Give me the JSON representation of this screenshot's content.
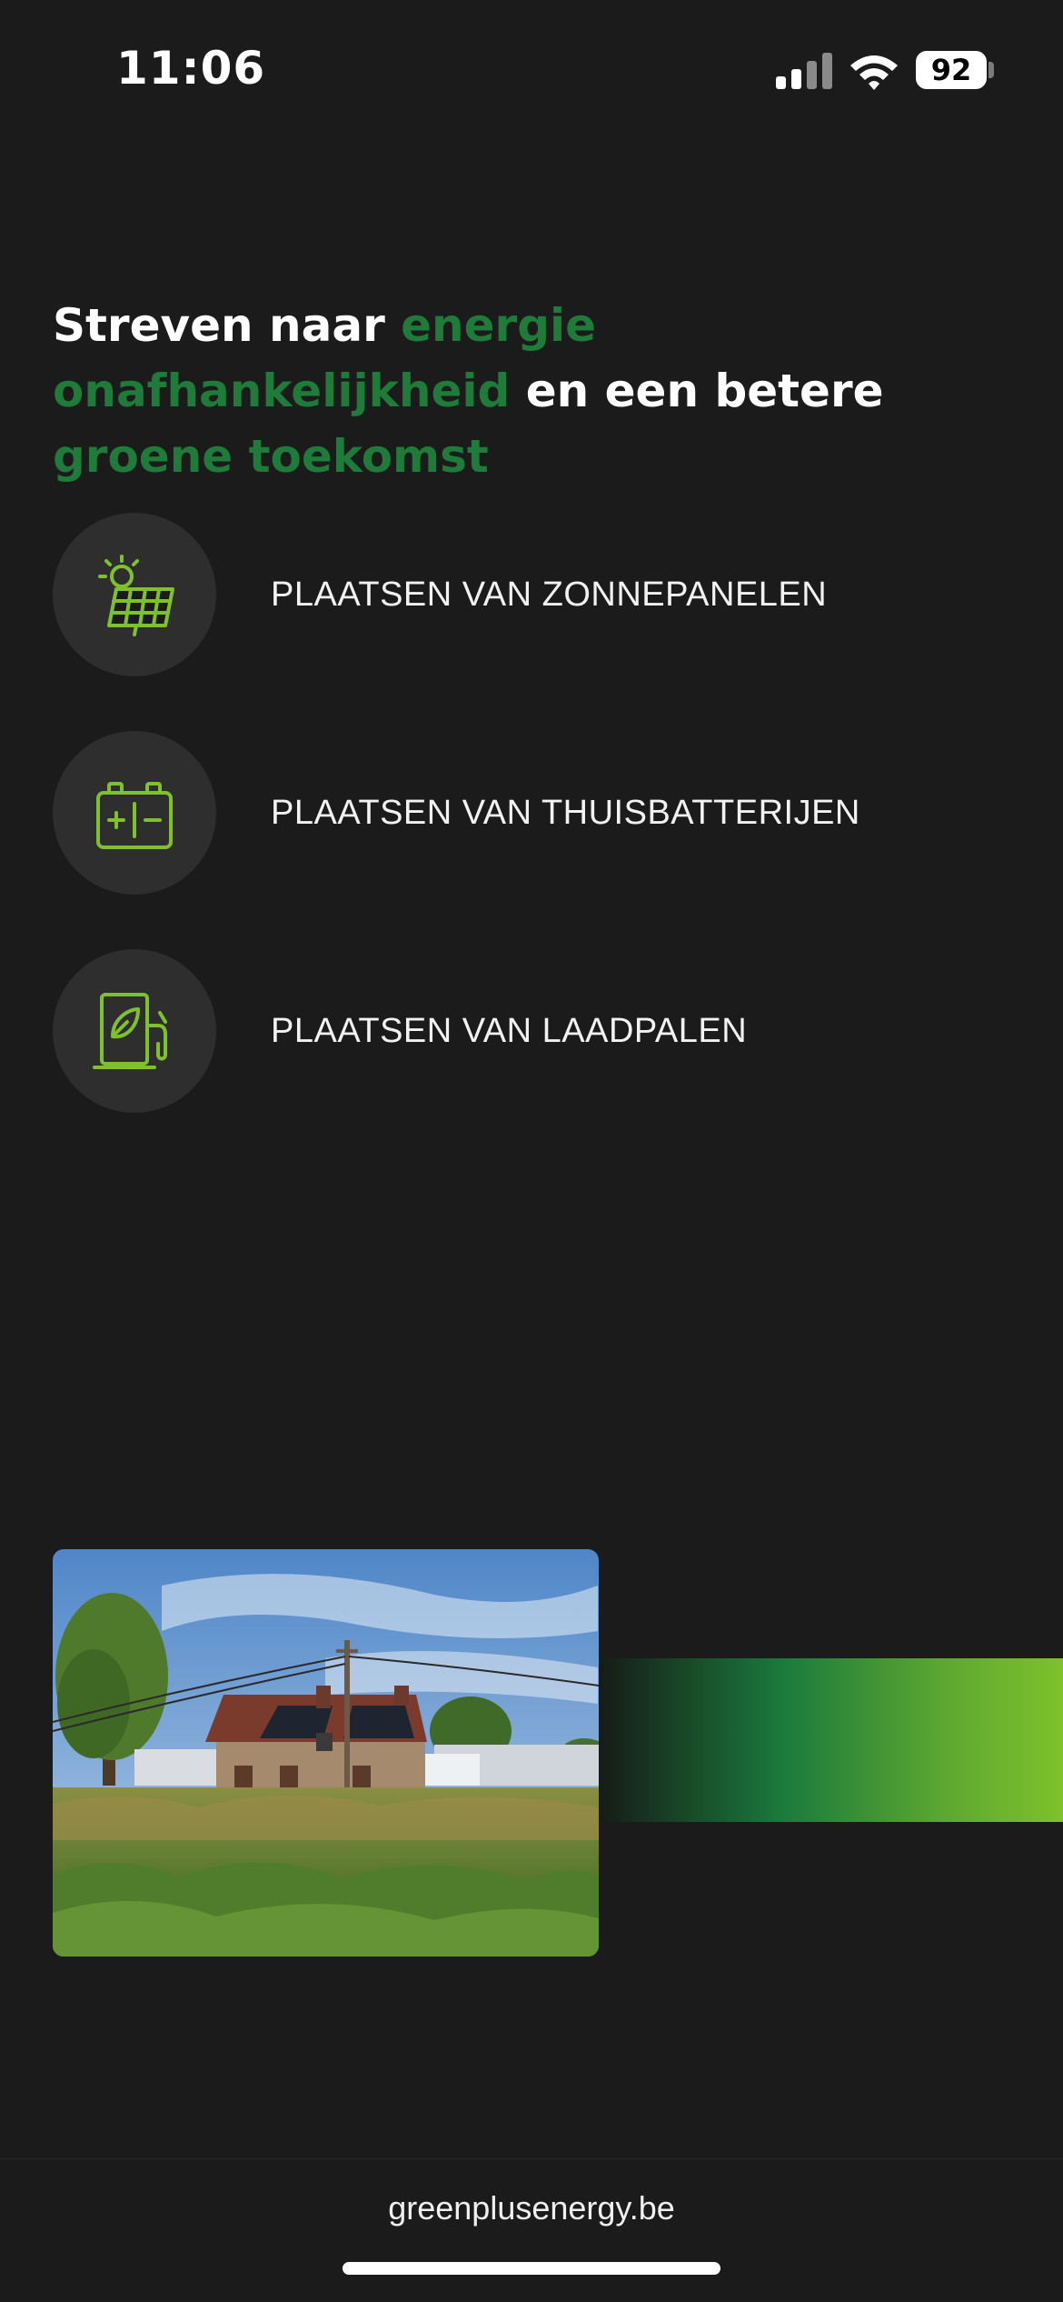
{
  "status_bar": {
    "time": "11:06",
    "battery": "92",
    "icons": [
      "cellular-signal-icon",
      "wifi-icon",
      "battery-icon"
    ]
  },
  "headline": {
    "part1": "Streven naar ",
    "highlight1": "energie onafhankelijkheid",
    "part2": " en een betere ",
    "highlight2": "groene toekomst"
  },
  "services": [
    {
      "label": "PLAATSEN VAN ZONNEPANELEN",
      "icon": "solar-panel-icon"
    },
    {
      "label": "PLAATSEN VAN THUISBATTERIJEN",
      "icon": "battery-icon"
    },
    {
      "label": "PLAATSEN VAN LAADPALEN",
      "icon": "ev-charger-icon"
    }
  ],
  "footer": {
    "domain": "greenplusenergy.be"
  },
  "colors": {
    "background": "#1b1b1b",
    "accent_green": "#1e7b3a",
    "icon_lime": "#7ec12c",
    "icon_circle": "#2e2e2e"
  }
}
